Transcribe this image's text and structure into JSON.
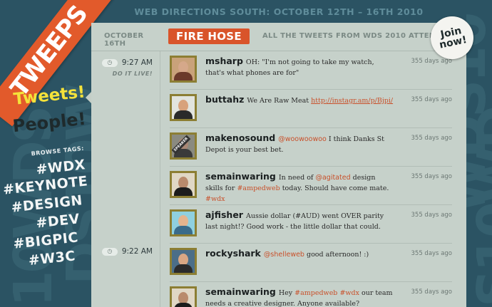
{
  "brand": {
    "name": "TWEEPS"
  },
  "banner": {
    "title": "WEB DIRECTIONS SOUTH: OCTOBER 12TH – 16TH 2010"
  },
  "background": {
    "letters": [
      "10WDS",
      "DS10W",
      "WDS10",
      "S10WD"
    ]
  },
  "nav": {
    "tweets_label": "Tweets!",
    "people_label": "People!",
    "browse_label": "BROWSE TAGS:",
    "tags": [
      "#WDX",
      "#KEYNOTE",
      "#DESIGN",
      "#DEV",
      "#BIGPIC",
      "#W3C"
    ]
  },
  "join": {
    "line1": "Join",
    "line2": "now!"
  },
  "header": {
    "date": "OCTOBER 16TH",
    "section": "FIRE HOSE",
    "description": "ALL THE TWEETS FROM WDS 2010 ATTENDEES"
  },
  "time_groups": [
    {
      "time": "9:27 AM",
      "note": "DO IT LIVE!",
      "icon": "clock-icon"
    },
    {
      "time": "9:22 AM",
      "note": "",
      "icon": "clock-icon"
    }
  ],
  "tweets": [
    {
      "user": "msharp",
      "pre": "OH: \"I'm not going to take my watch, that's what phones are for\"",
      "ago": "355 days ago",
      "colors": {
        "face": "#d5a88a",
        "body": "#6b3a2a",
        "bg": "#c9a27a"
      }
    },
    {
      "user": "buttahz",
      "pre": "We Are Raw Meat ",
      "link": "http://instagr.am/p/Bjpi/",
      "ago": "355 days ago",
      "colors": {
        "face": "#d8a27c",
        "body": "#2a2a2a",
        "bg": "#e2e4de"
      }
    },
    {
      "user": "makenosound",
      "mention": "@woowoowoo",
      "post": " I think Danks St Depot is your best bet.",
      "ago": "355 days ago",
      "badge": "SPEAKER",
      "colors": {
        "face": "#a98876",
        "body": "#3a3a3a",
        "bg": "#8a8a80"
      }
    },
    {
      "user": "semainwaring",
      "pre": "In need of ",
      "mention": "@agitated",
      "mid": " design skills for ",
      "hashtag1": "#ampedweb",
      "post": " today. Should have come mate. ",
      "hashtag2": "#wdx",
      "ago": "355 days ago",
      "colors": {
        "face": "#b98a6c",
        "body": "#1c1c1c",
        "bg": "#e0d7c5"
      }
    },
    {
      "user": "ajfisher",
      "pre": "Aussie dollar (#AUD) went OVER parity last night!? Good work - the little dollar that could.",
      "ago": "355 days ago",
      "colors": {
        "face": "#e4b48e",
        "body": "#3a6b8a",
        "bg": "#8fd0e0"
      }
    },
    {
      "user": "rockyshark",
      "mention": "@shelleweb",
      "post": " good afternoon! :)",
      "ago": "355 days ago",
      "colors": {
        "face": "#d9a784",
        "body": "#2b2b2b",
        "bg": "#4b6e88"
      }
    },
    {
      "user": "semainwaring",
      "pre": "Hey ",
      "hashtag1": "#ampedweb",
      "mid": " ",
      "hashtag2": "#wdx",
      "post": " our team needs a creative designer. Anyone available?",
      "ago": "355 days ago",
      "colors": {
        "face": "#b98a6c",
        "body": "#1c1c1c",
        "bg": "#e0d7c5"
      }
    }
  ]
}
